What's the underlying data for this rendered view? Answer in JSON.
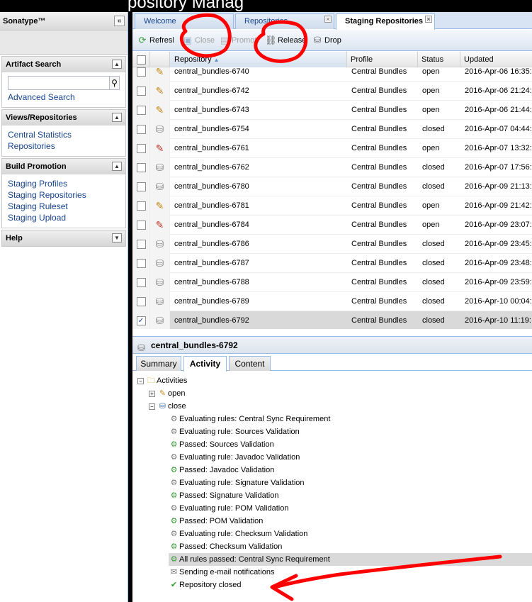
{
  "top_strip": {
    "partial_text": "pository Manag"
  },
  "sidebar": {
    "title": "Sonatype™",
    "collapse_glyph": "«",
    "panels": [
      {
        "title": "Artifact Search",
        "toggle": "▲",
        "links": [
          "Advanced Search"
        ]
      },
      {
        "title": "Views/Repositories",
        "toggle": "▲",
        "links": [
          "Central Statistics",
          "Repositories"
        ]
      },
      {
        "title": "Build Promotion",
        "toggle": "▲",
        "links": [
          "Staging Profiles",
          "Staging Repositories",
          "Staging Ruleset",
          "Staging Upload"
        ]
      },
      {
        "title": "Help",
        "toggle": "▼",
        "links": []
      }
    ]
  },
  "tabs": [
    {
      "label": "Welcome",
      "closable": false
    },
    {
      "label": "Repositories",
      "closable": true
    },
    {
      "label": "Staging Repositories",
      "closable": true,
      "active": true
    }
  ],
  "toolbar": {
    "refresh": "Refresh",
    "close": "Close",
    "promote": "Promote",
    "release": "Release",
    "drop": "Drop"
  },
  "grid": {
    "columns": [
      "Repository",
      "Profile",
      "Status",
      "Updated"
    ],
    "sort_indicator": "▲",
    "rows": [
      {
        "repository": "central_bundles-6740",
        "profile": "Central Bundles",
        "status": "open",
        "updated": "2016-Apr-06 16:35:",
        "icon": "edit-icon",
        "checked": false
      },
      {
        "repository": "central_bundles-6742",
        "profile": "Central Bundles",
        "status": "open",
        "updated": "2016-Apr-06 21:24:",
        "icon": "edit-icon",
        "checked": false
      },
      {
        "repository": "central_bundles-6743",
        "profile": "Central Bundles",
        "status": "open",
        "updated": "2016-Apr-06 21:44:",
        "icon": "edit-icon",
        "checked": false
      },
      {
        "repository": "central_bundles-6754",
        "profile": "Central Bundles",
        "status": "closed",
        "updated": "2016-Apr-07 04:44:",
        "icon": "database-icon",
        "checked": false
      },
      {
        "repository": "central_bundles-6761",
        "profile": "Central Bundles",
        "status": "open",
        "updated": "2016-Apr-07 13:32:",
        "icon": "edit-error-icon",
        "checked": false
      },
      {
        "repository": "central_bundles-6762",
        "profile": "Central Bundles",
        "status": "closed",
        "updated": "2016-Apr-07 17:56:",
        "icon": "database-icon",
        "checked": false
      },
      {
        "repository": "central_bundles-6780",
        "profile": "Central Bundles",
        "status": "closed",
        "updated": "2016-Apr-09 21:13:",
        "icon": "database-icon",
        "checked": false
      },
      {
        "repository": "central_bundles-6781",
        "profile": "Central Bundles",
        "status": "open",
        "updated": "2016-Apr-09 21:42:",
        "icon": "edit-icon",
        "checked": false
      },
      {
        "repository": "central_bundles-6784",
        "profile": "Central Bundles",
        "status": "open",
        "updated": "2016-Apr-09 23:07:",
        "icon": "edit-error-icon",
        "checked": false
      },
      {
        "repository": "central_bundles-6786",
        "profile": "Central Bundles",
        "status": "closed",
        "updated": "2016-Apr-09 23:45:",
        "icon": "database-icon",
        "checked": false
      },
      {
        "repository": "central_bundles-6787",
        "profile": "Central Bundles",
        "status": "closed",
        "updated": "2016-Apr-09 23:48:",
        "icon": "database-icon",
        "checked": false
      },
      {
        "repository": "central_bundles-6788",
        "profile": "Central Bundles",
        "status": "closed",
        "updated": "2016-Apr-09 23:59:",
        "icon": "database-icon",
        "checked": false
      },
      {
        "repository": "central_bundles-6789",
        "profile": "Central Bundles",
        "status": "closed",
        "updated": "2016-Apr-10 00:04:",
        "icon": "database-icon",
        "checked": false
      },
      {
        "repository": "central_bundles-6792",
        "profile": "Central Bundles",
        "status": "closed",
        "updated": "2016-Apr-10 11:19:",
        "icon": "database-icon",
        "checked": true,
        "selected": true
      }
    ]
  },
  "details": {
    "title": "central_bundles-6792",
    "tabs": [
      "Summary",
      "Activity",
      "Content"
    ],
    "active_tab": "Activity"
  },
  "tree": [
    {
      "label": "Activities",
      "icon": "folder-icon",
      "expander": "⊟",
      "level": 0
    },
    {
      "label": "open",
      "icon": "edit-icon",
      "expander": "⊞",
      "level": 1
    },
    {
      "label": "close",
      "icon": "database-icon",
      "expander": "⊟",
      "level": 1
    },
    {
      "label": "Evaluating rules: Central Sync Requirement",
      "icon": "gears-icon",
      "level": 2
    },
    {
      "label": "Evaluating rule: Sources Validation",
      "icon": "gear-icon",
      "level": 2
    },
    {
      "label": "Passed: Sources Validation",
      "icon": "gear-ok-icon",
      "level": 2
    },
    {
      "label": "Evaluating rule: Javadoc Validation",
      "icon": "gear-icon",
      "level": 2
    },
    {
      "label": "Passed: Javadoc Validation",
      "icon": "gear-ok-icon",
      "level": 2
    },
    {
      "label": "Evaluating rule: Signature Validation",
      "icon": "gear-icon",
      "level": 2
    },
    {
      "label": "Passed: Signature Validation",
      "icon": "gear-ok-icon",
      "level": 2
    },
    {
      "label": "Evaluating rule: POM Validation",
      "icon": "gear-icon",
      "level": 2
    },
    {
      "label": "Passed: POM Validation",
      "icon": "gear-ok-icon",
      "level": 2
    },
    {
      "label": "Evaluating rule: Checksum Validation",
      "icon": "gear-icon",
      "level": 2
    },
    {
      "label": "Passed: Checksum Validation",
      "icon": "gear-ok-icon",
      "level": 2
    },
    {
      "label": "All rules passed: Central Sync Requirement",
      "icon": "gears-ok-icon",
      "level": 2,
      "highlight": true
    },
    {
      "label": "Sending e-mail notifications",
      "icon": "envelope-icon",
      "level": 2
    },
    {
      "label": "Repository closed",
      "icon": "check-circle-icon",
      "level": 2
    }
  ],
  "colors": {
    "annotation_red": "#ff0000",
    "link_blue": "#15428b",
    "panel_border": "#99bbe8"
  }
}
